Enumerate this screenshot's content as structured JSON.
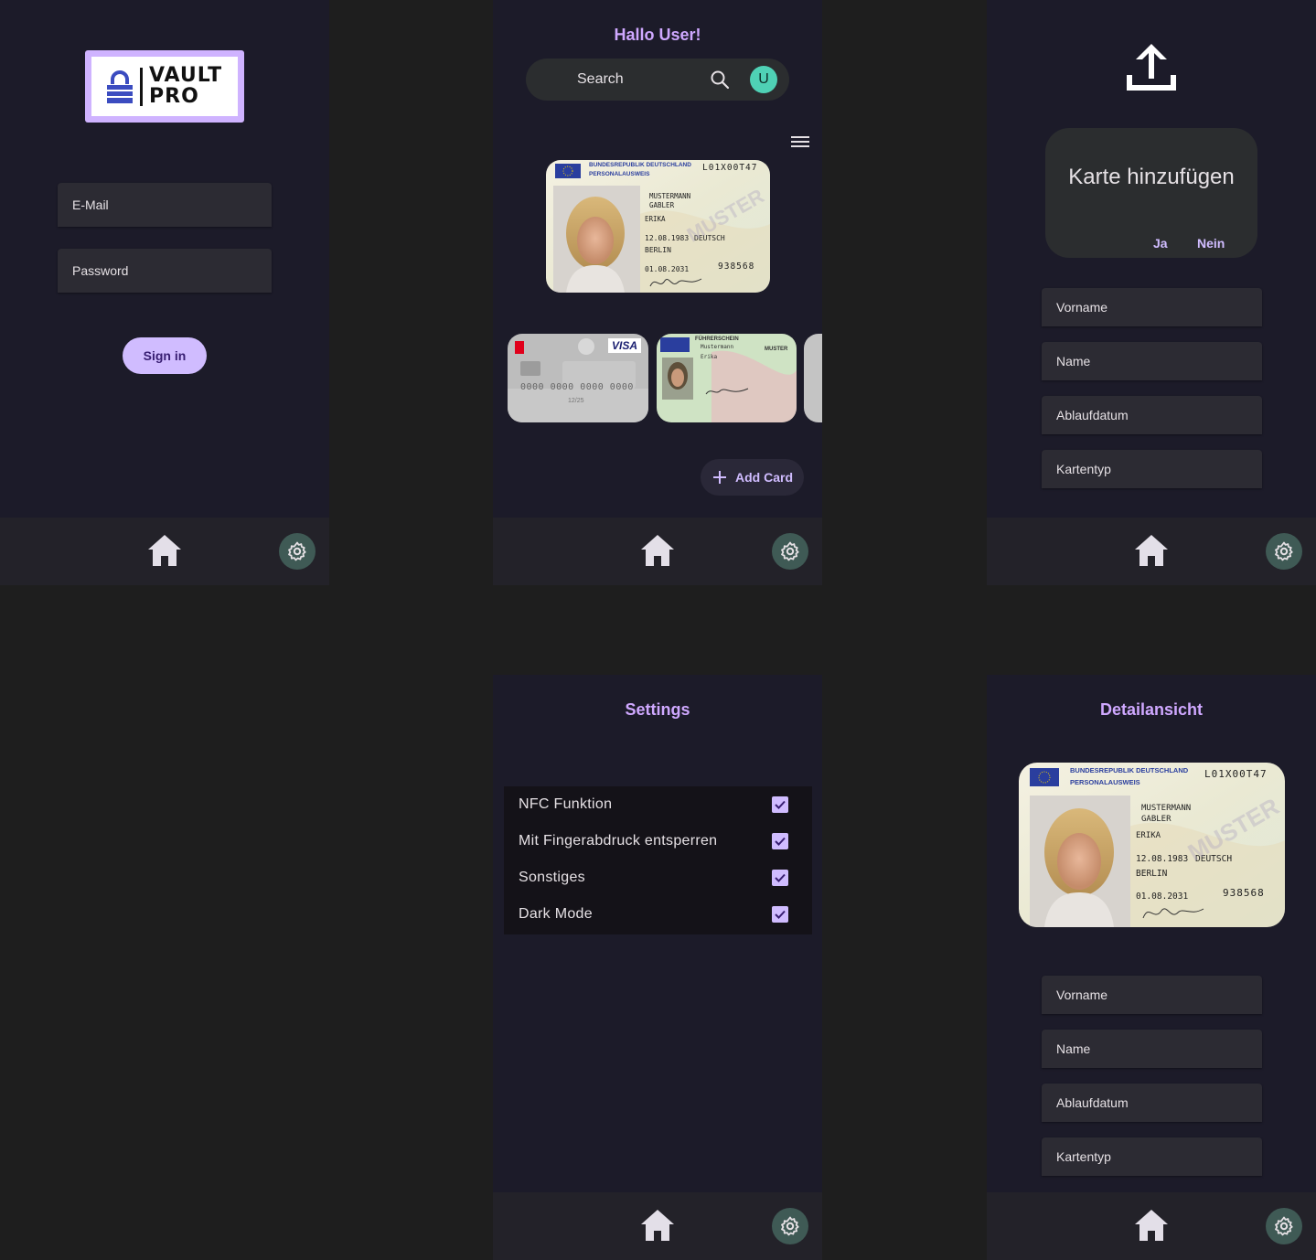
{
  "login": {
    "logo_line1": "VAULT",
    "logo_line2": "PRO",
    "email_placeholder": "E-Mail",
    "password_placeholder": "Password",
    "signin_label": "Sign in"
  },
  "home": {
    "greeting": "Hallo User!",
    "search_placeholder": "Search",
    "avatar_letter": "U",
    "add_card_label": "Add Card",
    "id_card": {
      "header": "BUNDESREPUBLIK DEUTSCHLAND",
      "subheader": "PERSONALAUSWEIS",
      "number": "L01X00T47",
      "surname": "MUSTERMANN",
      "birthname": "GABLER",
      "given": "ERIKA",
      "dob": "12.08.1983",
      "nationality": "DEUTSCH",
      "place": "BERLIN",
      "expiry": "01.08.2031",
      "can": "938568",
      "watermark": "MUSTER"
    },
    "visa": {
      "brand": "VISA",
      "number": "0000 0000 0000 0000",
      "expiry": "12/25"
    },
    "license": {
      "header": "FÜHRERSCHEIN",
      "name": "Mustermann",
      "given": "Erika",
      "watermark": "MUSTER"
    }
  },
  "add": {
    "dialog_title": "Karte hinzufügen",
    "yes_label": "Ja",
    "no_label": "Nein",
    "fields": [
      "Vorname",
      "Name",
      "Ablaufdatum",
      "Kartentyp"
    ]
  },
  "settings": {
    "title": "Settings",
    "items": [
      {
        "label": "NFC Funktion",
        "checked": true
      },
      {
        "label": "Mit Fingerabdruck entsperren",
        "checked": true
      },
      {
        "label": "Sonstiges",
        "checked": true
      },
      {
        "label": "Dark Mode",
        "checked": true
      }
    ]
  },
  "detail": {
    "title": "Detailansicht",
    "fields": [
      "Vorname",
      "Name",
      "Ablaufdatum",
      "Kartentyp"
    ]
  },
  "colors": {
    "accent": "#d0bcff",
    "title": "#cfa8ff",
    "surface": "#1c1b29",
    "field": "#2c2b33",
    "avatar": "#4fd1b5",
    "settings_fab": "#3f5a55"
  }
}
